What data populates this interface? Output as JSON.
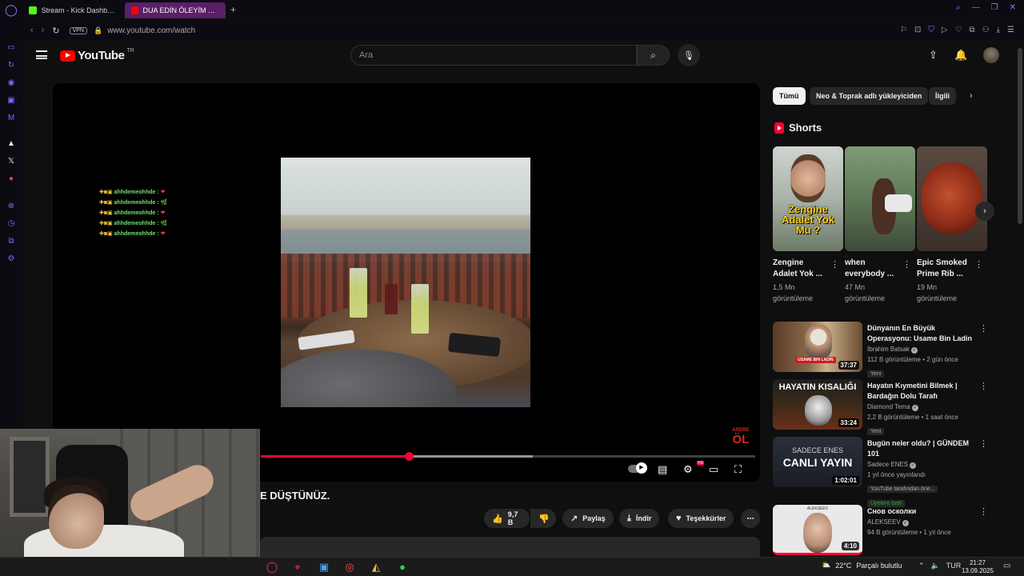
{
  "browser": {
    "tabs": [
      {
        "label": "Stream - Kick Dashboard",
        "icon": "kick-icon"
      },
      {
        "label": "DUA EDİN ÖLEYİM YOKSA",
        "icon": "youtube-icon"
      }
    ],
    "url": "www.youtube.com/watch",
    "vpn_label": "VPN"
  },
  "youtube": {
    "logo_text": "YouTube",
    "region": "TR",
    "search_placeholder": "Ara"
  },
  "player": {
    "chat_lines": [
      {
        "user": "ahhdemeohhde",
        "emoji": "heart"
      },
      {
        "user": "ahhdemeohhde",
        "emoji": "plant"
      },
      {
        "user": "ahhdemeohhde",
        "emoji": "heart"
      },
      {
        "user": "ahhdemeohhde",
        "emoji": "plant"
      },
      {
        "user": "ahhdemeohhde",
        "emoji": "heart"
      }
    ],
    "watermark_top": "ARDRE",
    "watermark_main": "ÖL",
    "progress_played": 0.3,
    "progress_loaded": 0.55
  },
  "video": {
    "title_visible": "E DÜŞTÜNÜZ.",
    "like_count": "9,7 B",
    "share_label": "Paylaş",
    "download_label": "İndir",
    "thanks_label": "Teşekkürler"
  },
  "chips": [
    {
      "label": "Tümü",
      "active": true
    },
    {
      "label": "Neo & Toprak adlı yükleyiciden",
      "active": false
    },
    {
      "label": "İlgili",
      "active": false
    }
  ],
  "shorts": {
    "heading": "Shorts",
    "items": [
      {
        "title": "Zengine Adalet Yok ...",
        "views": "1,5 Mn görüntüleme",
        "overlay": "Zengine Adalet Yok Mu ?"
      },
      {
        "title": "when everybody ...",
        "views": "47 Mn görüntüleme"
      },
      {
        "title": "Epic Smoked Prime Rib ...",
        "views": "19 Mn görüntüleme"
      }
    ]
  },
  "recommendations": [
    {
      "title": "Dünyanın En Büyük Operasyonu: Usame Bin Ladin Gerçekten ...",
      "channel": "İbrahim Balsak",
      "verified": true,
      "meta": "112 B görüntüleme • 2 gün önce",
      "badges": [
        "Yeni"
      ],
      "duration": "37:37",
      "thumb_text": "USAME BIN LADIN"
    },
    {
      "title": "Hayatın Kıymetini Bilmek | Bardağın Dolu Tarafı",
      "channel": "Diamond Tema",
      "verified": true,
      "meta": "2,2 B görüntüleme • 1 saat önce",
      "badges": [
        "Yeni"
      ],
      "duration": "33:24",
      "thumb_text": "HAYATIN KISALIĞI"
    },
    {
      "title": "Bugün neler oldu? | GÜNDEM 101",
      "channel": "Sadece ENES",
      "verified": true,
      "meta": "1 yıl önce yayınlandı",
      "badges": [
        "YouTube tarafından öne...",
        "Üyelere özel"
      ],
      "duration": "1:02:01",
      "thumb_text": "CANLI YAYIN",
      "thumb_sub": "SADECE ENES"
    },
    {
      "title": "Снов осколки",
      "channel": "ALEKSEEV",
      "verified": true,
      "meta": "94 B görüntüleme • 1 yıl önce",
      "badges": [],
      "duration": "4:10",
      "thumb_text": "ALEKSEEV"
    }
  ],
  "taskbar": {
    "weather_temp": "22°C",
    "weather_desc": "Parçalı bulutlu",
    "language": "TUR",
    "time": "21:27",
    "date": "13.09.2025"
  },
  "colors": {
    "yt_red": "#ff0033",
    "opera_purple": "#8f7cff",
    "active_tab": "#5a1f66"
  }
}
